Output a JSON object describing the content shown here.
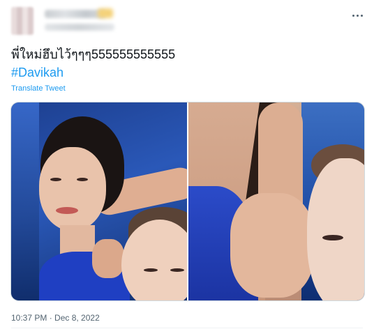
{
  "tweet": {
    "text": "พี่ใหม่ฮึบไว้ๆๆๆ555555555555",
    "hashtag": "#Davikah",
    "translate_label": "Translate Tweet",
    "timestamp": "10:37 PM · Dec 8, 2022"
  },
  "colors": {
    "text": "#0f1419",
    "link": "#1d9bf0",
    "secondary": "#536471"
  },
  "icons": {
    "more": "more-horizontal-icon"
  }
}
